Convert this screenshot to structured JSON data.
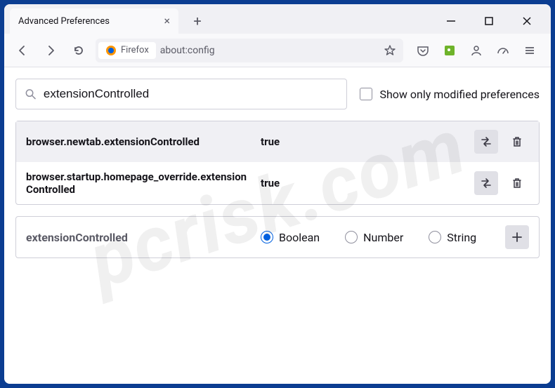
{
  "titlebar": {
    "tab_title": "Advanced Preferences"
  },
  "toolbar": {
    "identity_label": "Firefox",
    "url": "about:config"
  },
  "search": {
    "value": "extensionControlled",
    "show_modified_label": "Show only modified preferences"
  },
  "prefs": [
    {
      "name": "browser.newtab.extensionControlled",
      "value": "true"
    },
    {
      "name": "browser.startup.homepage_override.extensionControlled",
      "value": "true"
    }
  ],
  "new_pref": {
    "name": "extensionControlled",
    "types": [
      "Boolean",
      "Number",
      "String"
    ],
    "selected": "Boolean"
  },
  "watermark": "pcrisk.com"
}
